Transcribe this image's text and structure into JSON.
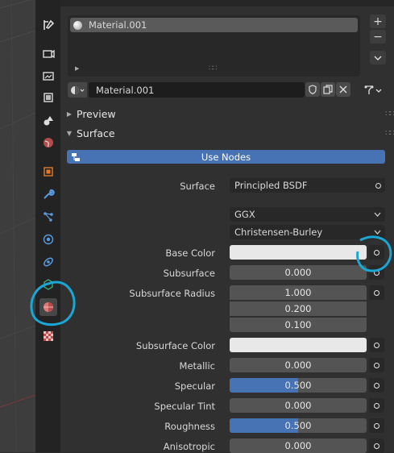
{
  "material_slots": {
    "items": [
      "Material.001"
    ],
    "add_label": "+",
    "remove_label": "−"
  },
  "material_selector": {
    "name": "Material.001"
  },
  "sections": {
    "preview": "Preview",
    "surface": "Surface"
  },
  "use_nodes_label": "Use Nodes",
  "surface": {
    "label": "Surface",
    "shader": "Principled BSDF",
    "distribution": "GGX",
    "subsurface_method": "Christensen-Burley"
  },
  "properties": {
    "base_color": {
      "label": "Base Color",
      "color": "#e8e8e8"
    },
    "subsurface": {
      "label": "Subsurface",
      "value": "0.000",
      "fraction": 0
    },
    "subsurface_radius": {
      "label": "Subsurface Radius",
      "values": [
        "1.000",
        "0.200",
        "0.100"
      ]
    },
    "subsurface_color": {
      "label": "Subsurface Color",
      "color": "#e8e8e8"
    },
    "metallic": {
      "label": "Metallic",
      "value": "0.000",
      "fraction": 0
    },
    "specular": {
      "label": "Specular",
      "value": "0.500",
      "fraction": 0.5
    },
    "specular_tint": {
      "label": "Specular Tint",
      "value": "0.000",
      "fraction": 0
    },
    "roughness": {
      "label": "Roughness",
      "value": "0.500",
      "fraction": 0.5
    },
    "anisotropic": {
      "label": "Anisotropic",
      "value": "0.000",
      "fraction": 0
    }
  },
  "colors": {
    "accent": "#4772b3",
    "annotation": "#1aa7d4",
    "panel": "#303030",
    "field": "#545454"
  }
}
